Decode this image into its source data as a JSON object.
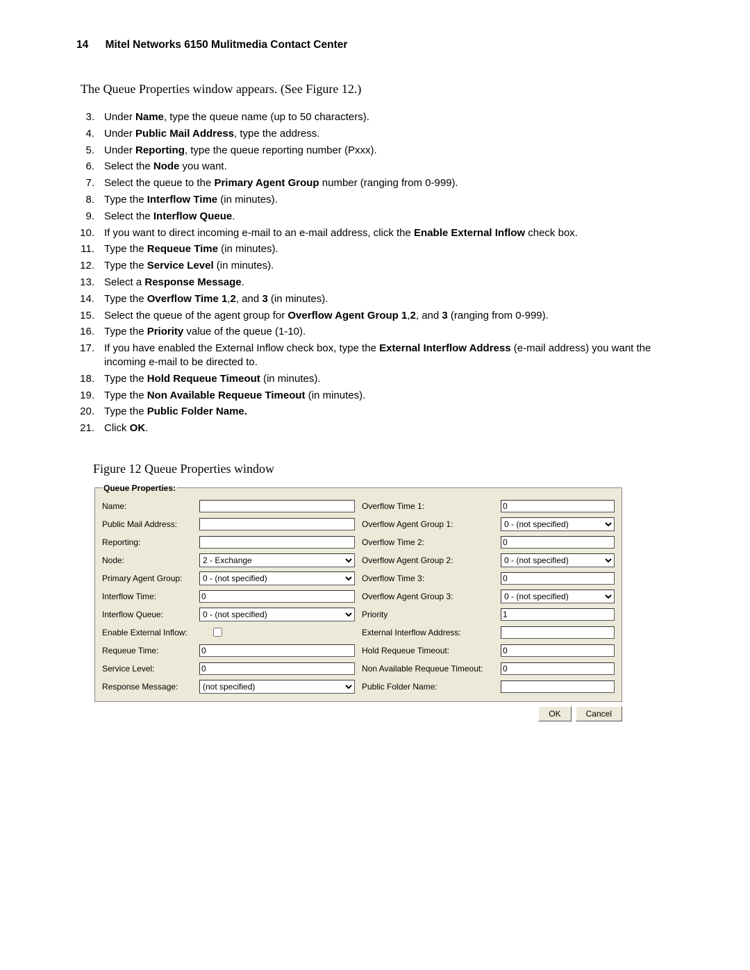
{
  "header": {
    "page_number": "14",
    "title": "Mitel Networks 6150 Mulitmedia Contact Center"
  },
  "intro": "The Queue Properties window appears. (See Figure 12.)",
  "steps": [
    {
      "n": "3.",
      "pre": "Under ",
      "b": "Name",
      "post": ", type the queue name (up to 50 characters)."
    },
    {
      "n": "4.",
      "pre": "Under ",
      "b": "Public Mail Address",
      "post": ", type the address."
    },
    {
      "n": "5.",
      "pre": "Under ",
      "b": "Reporting",
      "post": ", type the queue reporting number (Pxxx)."
    },
    {
      "n": "6.",
      "pre": "Select the ",
      "b": "Node",
      "post": " you want."
    },
    {
      "n": "7.",
      "pre": "Select the queue to the ",
      "b": "Primary Agent Group",
      "post": " number (ranging from 0-999)."
    },
    {
      "n": "8.",
      "pre": "Type the ",
      "b": "Interflow Time",
      "post": " (in minutes)."
    },
    {
      "n": "9.",
      "pre": "Select the ",
      "b": "Interflow Queue",
      "post": "."
    },
    {
      "n": "10.",
      "pre": "If you want to direct incoming e-mail to an e-mail address, click the ",
      "b": "Enable External Inflow",
      "post": " check box."
    },
    {
      "n": "11.",
      "pre": "Type the ",
      "b": "Requeue Time",
      "post": " (in minutes)."
    },
    {
      "n": "12.",
      "pre": "Type the ",
      "b": "Service Level",
      "post": " (in minutes)."
    },
    {
      "n": "13.",
      "pre": "Select a ",
      "b": "Response Message",
      "post": "."
    },
    {
      "n": "14.",
      "pre": "Type the ",
      "b": "Overflow Time 1",
      "b2": "2",
      "b3": "3",
      "mid": ",",
      "mid2": ", and ",
      "post": " (in minutes)."
    },
    {
      "n": "15.",
      "pre": "Select the queue of the agent group for ",
      "b": "Overflow Agent Group 1",
      "b2": "2",
      "b3": "3",
      "mid": ",",
      "mid2": ", and ",
      "post": " (ranging from 0-999)."
    },
    {
      "n": "16.",
      "pre": "Type the ",
      "b": "Priority",
      "post": " value of the queue (1-10)."
    },
    {
      "n": "17.",
      "pre": "If you have enabled the External Inflow check box, type the ",
      "b": "External Interflow Address",
      "post": " (e-mail address) you want the incoming e-mail to be directed to."
    },
    {
      "n": "18.",
      "pre": "Type the ",
      "b": "Hold Requeue Timeout",
      "post": " (in minutes)."
    },
    {
      "n": "19.",
      "pre": "Type the ",
      "b": "Non Available Requeue Timeout",
      "post": " (in minutes)."
    },
    {
      "n": "20.",
      "pre": "Type the ",
      "b": "Public Folder Name.",
      "post": ""
    },
    {
      "n": "21.",
      "pre": "Click ",
      "b": "OK",
      "post": "."
    }
  ],
  "figure_caption": "Figure 12   Queue Properties window",
  "form": {
    "legend": "Queue Properties:",
    "left": {
      "name": {
        "label": "Name:",
        "value": ""
      },
      "public_mail": {
        "label": "Public Mail Address:",
        "value": ""
      },
      "reporting": {
        "label": "Reporting:",
        "value": ""
      },
      "node": {
        "label": "Node:",
        "value": "2 - Exchange"
      },
      "primary_agent_group": {
        "label": "Primary Agent Group:",
        "value": "0 - (not specified)"
      },
      "interflow_time": {
        "label": "Interflow Time:",
        "value": "0"
      },
      "interflow_queue": {
        "label": "Interflow Queue:",
        "value": "0 - (not specified)"
      },
      "enable_external_inflow": {
        "label": "Enable External Inflow:",
        "checked": false
      },
      "requeue_time": {
        "label": "Requeue Time:",
        "value": "0"
      },
      "service_level": {
        "label": "Service Level:",
        "value": "0"
      },
      "response_message": {
        "label": "Response Message:",
        "value": "(not specified)"
      }
    },
    "right": {
      "overflow_time_1": {
        "label": "Overflow Time 1:",
        "value": "0"
      },
      "overflow_agent_group_1": {
        "label": "Overflow Agent Group 1:",
        "value": "0 - (not specified)"
      },
      "overflow_time_2": {
        "label": "Overflow Time 2:",
        "value": "0"
      },
      "overflow_agent_group_2": {
        "label": "Overflow Agent Group 2:",
        "value": "0 - (not specified)"
      },
      "overflow_time_3": {
        "label": "Overflow Time 3:",
        "value": "0"
      },
      "overflow_agent_group_3": {
        "label": "Overflow Agent Group 3:",
        "value": "0 - (not specified)"
      },
      "priority": {
        "label": "Priority",
        "value": "1"
      },
      "external_interflow_address": {
        "label": "External Interflow Address:",
        "value": ""
      },
      "hold_requeue_timeout": {
        "label": "Hold Requeue Timeout:",
        "value": "0"
      },
      "non_available_requeue_timeout": {
        "label": "Non Available Requeue Timeout:",
        "value": "0"
      },
      "public_folder_name": {
        "label": "Public Folder Name:",
        "value": ""
      }
    },
    "buttons": {
      "ok": "OK",
      "cancel": "Cancel"
    }
  }
}
